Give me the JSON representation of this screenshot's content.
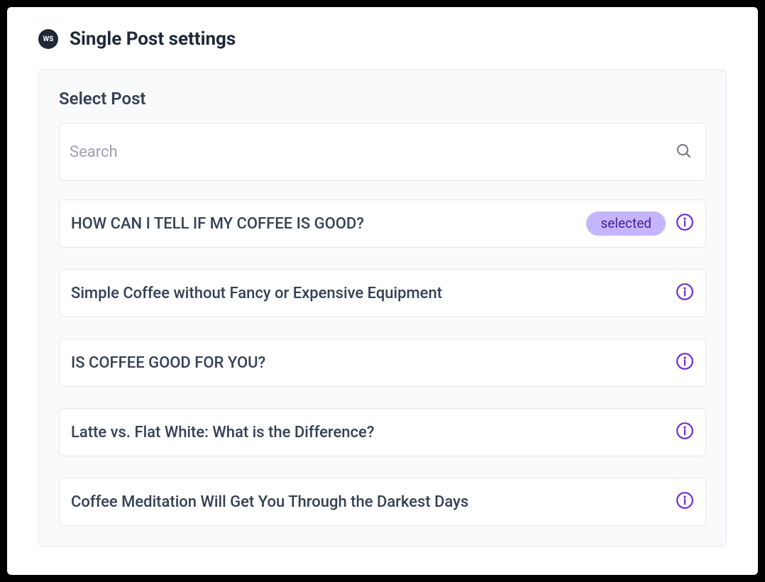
{
  "header": {
    "badge": "WS",
    "title": "Single Post settings"
  },
  "panel": {
    "title": "Select Post",
    "search": {
      "placeholder": "Search",
      "value": ""
    },
    "selectedBadge": "selected",
    "posts": [
      {
        "title": "HOW CAN I TELL IF MY COFFEE IS GOOD?",
        "selected": true
      },
      {
        "title": "Simple Coffee without Fancy or Expensive Equipment",
        "selected": false
      },
      {
        "title": "IS COFFEE GOOD FOR YOU?",
        "selected": false
      },
      {
        "title": "Latte vs. Flat White: What is the Difference?",
        "selected": false
      },
      {
        "title": "Coffee Meditation Will Get You Through the Darkest Days",
        "selected": false
      }
    ]
  },
  "colors": {
    "accent": "#6d28d9",
    "badgeBg": "#c4b5fd",
    "text": "#334155"
  }
}
